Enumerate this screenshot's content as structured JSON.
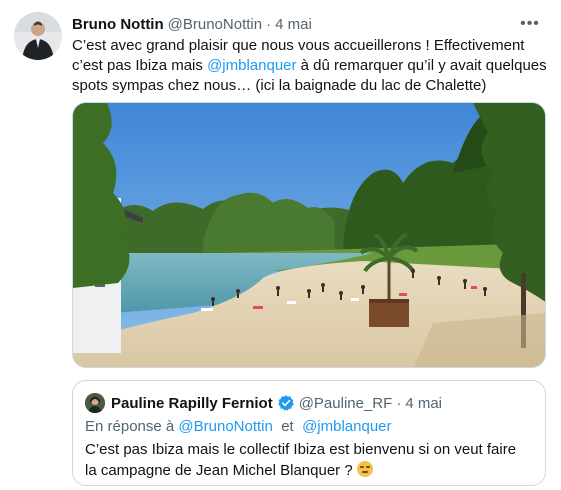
{
  "tweet": {
    "author_name": "Bruno Nottin",
    "author_handle": "@BrunoNottin",
    "separator": "·",
    "date": "4 mai",
    "more_label": "•••",
    "text_part1": "C’est avec grand plaisir que nous vous accueillerons ! Effectivement c’est pas Ibiza mais ",
    "mention": "@jmblanquer",
    "text_part2": " à dû remarquer qu’il y avait quelques spots sympas chez nous… (ici la baignade du lac de Chalette)",
    "avatar_icon": "user-avatar",
    "photo_alt": "lake-beach-photo"
  },
  "quote": {
    "author_name": "Pauline Rapilly Ferniot",
    "author_handle": "@Pauline_RF",
    "separator": "·",
    "date": "4 mai",
    "verified_icon": "verified-badge-icon",
    "reply_prefix": "En réponse à",
    "reply_to_1": "@BrunoNottin",
    "reply_conjunction": "et",
    "reply_to_2": "@jmblanquer",
    "text": "C’est pas Ibiza mais le collectif Ibiza est bienvenu si on veut faire la campagne de Jean Michel Blanquer ?",
    "emoji_icon": "smirk-emoji-icon"
  },
  "colors": {
    "accent": "#1d9bf0",
    "text": "#0f1419",
    "muted": "#536471",
    "border": "#cfd9de"
  }
}
